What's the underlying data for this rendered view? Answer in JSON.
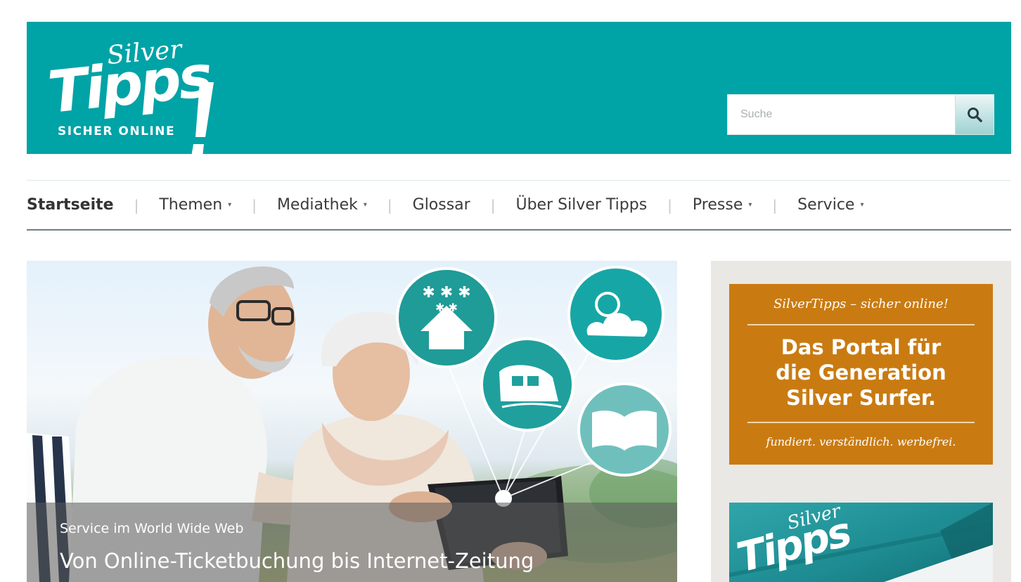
{
  "header": {
    "logo": {
      "silver": "Silver",
      "tipps": "Tipps",
      "tagline": "SICHER ONLINE"
    },
    "search": {
      "placeholder": "Suche",
      "value": "",
      "icon": "search-icon"
    }
  },
  "nav": {
    "items": [
      {
        "label": "Startseite",
        "active": true,
        "has_dropdown": false
      },
      {
        "label": "Themen",
        "active": false,
        "has_dropdown": true
      },
      {
        "label": "Mediathek",
        "active": false,
        "has_dropdown": true
      },
      {
        "label": "Glossar",
        "active": false,
        "has_dropdown": false
      },
      {
        "label": "Über Silver Tipps",
        "active": false,
        "has_dropdown": false
      },
      {
        "label": "Presse",
        "active": false,
        "has_dropdown": true
      },
      {
        "label": "Service",
        "active": false,
        "has_dropdown": true
      }
    ],
    "separator": "|",
    "caret": "▾"
  },
  "hero": {
    "kicker": "Service im World Wide Web",
    "title": "Von Online-Ticketbuchung bis Internet-Zeitung",
    "icons": [
      "hotel-stars-icon",
      "train-icon",
      "weather-icon",
      "book-icon"
    ]
  },
  "sidebar": {
    "promo": {
      "top": "SilverTipps – sicher online!",
      "main": [
        "Das Portal für",
        "die Generation",
        "Silver Surfer."
      ],
      "bottom": "fundiert. verständlich. werbefrei."
    },
    "card2": {
      "silver": "Silver",
      "tipps": "Tipps"
    }
  },
  "colors": {
    "brand_teal": "#00a3a6",
    "promo_orange": "#c97b12",
    "sidebar_bg": "#e9e8e4",
    "nav_text": "#3b3b3b"
  }
}
